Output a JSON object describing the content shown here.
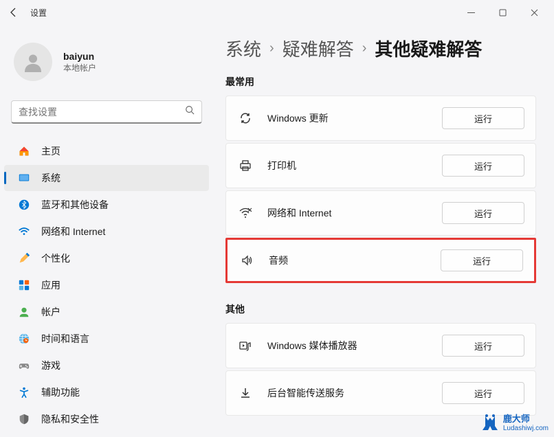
{
  "window": {
    "title": "设置"
  },
  "profile": {
    "username": "baiyun",
    "accountType": "本地帐户"
  },
  "search": {
    "placeholder": "查找设置"
  },
  "nav": [
    {
      "label": "主页",
      "icon": "home"
    },
    {
      "label": "系统",
      "icon": "system",
      "active": true
    },
    {
      "label": "蓝牙和其他设备",
      "icon": "bluetooth"
    },
    {
      "label": "网络和 Internet",
      "icon": "wifi"
    },
    {
      "label": "个性化",
      "icon": "personalize"
    },
    {
      "label": "应用",
      "icon": "apps"
    },
    {
      "label": "帐户",
      "icon": "accounts"
    },
    {
      "label": "时间和语言",
      "icon": "time"
    },
    {
      "label": "游戏",
      "icon": "gaming"
    },
    {
      "label": "辅助功能",
      "icon": "accessibility"
    },
    {
      "label": "隐私和安全性",
      "icon": "privacy"
    }
  ],
  "breadcrumb": {
    "level1": "系统",
    "level2": "疑难解答",
    "level3": "其他疑难解答"
  },
  "sections": {
    "frequent": {
      "title": "最常用",
      "items": [
        {
          "label": "Windows 更新",
          "icon": "refresh",
          "action": "运行"
        },
        {
          "label": "打印机",
          "icon": "printer",
          "action": "运行"
        },
        {
          "label": "网络和 Internet",
          "icon": "wifi",
          "action": "运行"
        },
        {
          "label": "音频",
          "icon": "audio",
          "action": "运行",
          "highlighted": true
        }
      ]
    },
    "other": {
      "title": "其他",
      "items": [
        {
          "label": "Windows 媒体播放器",
          "icon": "media",
          "action": "运行"
        },
        {
          "label": "后台智能传送服务",
          "icon": "download",
          "action": "运行"
        }
      ]
    }
  },
  "watermark": {
    "brand": "鹿大师",
    "url": "Ludashiwj.com"
  }
}
